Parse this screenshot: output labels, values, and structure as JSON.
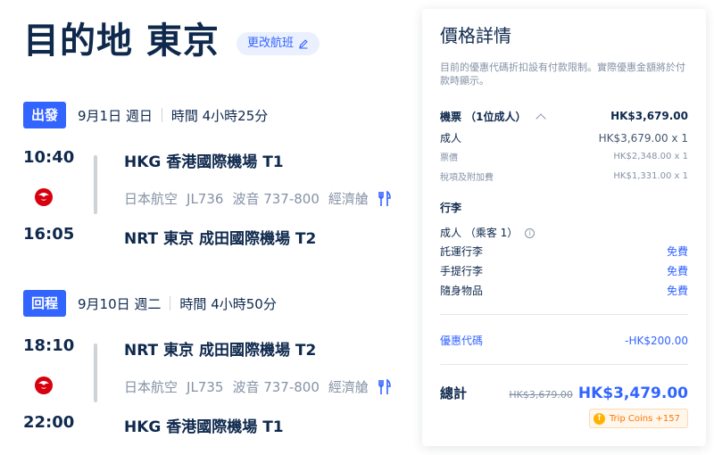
{
  "header": {
    "title": "目的地 東京",
    "change_flight": "更改航班"
  },
  "outbound": {
    "badge": "出發",
    "date": "9月1日 週日",
    "duration": "時間 4小時25分",
    "depart_time": "10:40",
    "depart_airport": "HKG 香港國際機場 T1",
    "airline": "日本航空",
    "flight_no": "JL736",
    "aircraft": "波音 737-800",
    "cabin": "經濟艙",
    "arrive_time": "16:05",
    "arrive_airport": "NRT 東京 成田國際機場 T2"
  },
  "return": {
    "badge": "回程",
    "date": "9月10日 週二",
    "duration": "時間 4小時50分",
    "depart_time": "18:10",
    "depart_airport": "NRT 東京 成田國際機場 T2",
    "airline": "日本航空",
    "flight_no": "JL735",
    "aircraft": "波音 737-800",
    "cabin": "經濟艙",
    "arrive_time": "22:00",
    "arrive_airport": "HKG 香港國際機場 T1"
  },
  "price": {
    "title": "價格詳情",
    "note": "目前的優惠代碼折扣設有付款限制。實際優惠金額將於付款時顯示。",
    "ticket_label": "機票 （1位成人）",
    "ticket_total": "HK$3,679.00",
    "adult_label": "成人",
    "adult_value": "HK$3,679.00 x 1",
    "fare_label": "票價",
    "fare_value": "HK$2,348.00 x 1",
    "tax_label": "稅項及附加費",
    "tax_value": "HK$1,331.00 x 1",
    "baggage_title": "行李",
    "baggage_pax": "成人 （乘客 1）",
    "checked_label": "託運行李",
    "checked_value": "免費",
    "carryon_label": "手提行李",
    "carryon_value": "免費",
    "personal_label": "隨身物品",
    "personal_value": "免費",
    "promo_label": "優惠代碼",
    "promo_value": "-HK$200.00",
    "total_label": "總計",
    "total_old": "HK$3,679.00",
    "total_new": "HK$3,479.00",
    "coins": "Trip Coins +157"
  },
  "icons": {
    "edit": "pencil-icon",
    "meal": "fork-knife-icon",
    "airline_logo": "japan-airlines-crane-icon",
    "collapse": "chevron-up-icon",
    "info": "info-icon",
    "coin": "coin-icon"
  },
  "colors": {
    "accent": "#3264ff",
    "text": "#0f294d",
    "muted": "#8592a6",
    "airline_red": "#d7000f"
  }
}
